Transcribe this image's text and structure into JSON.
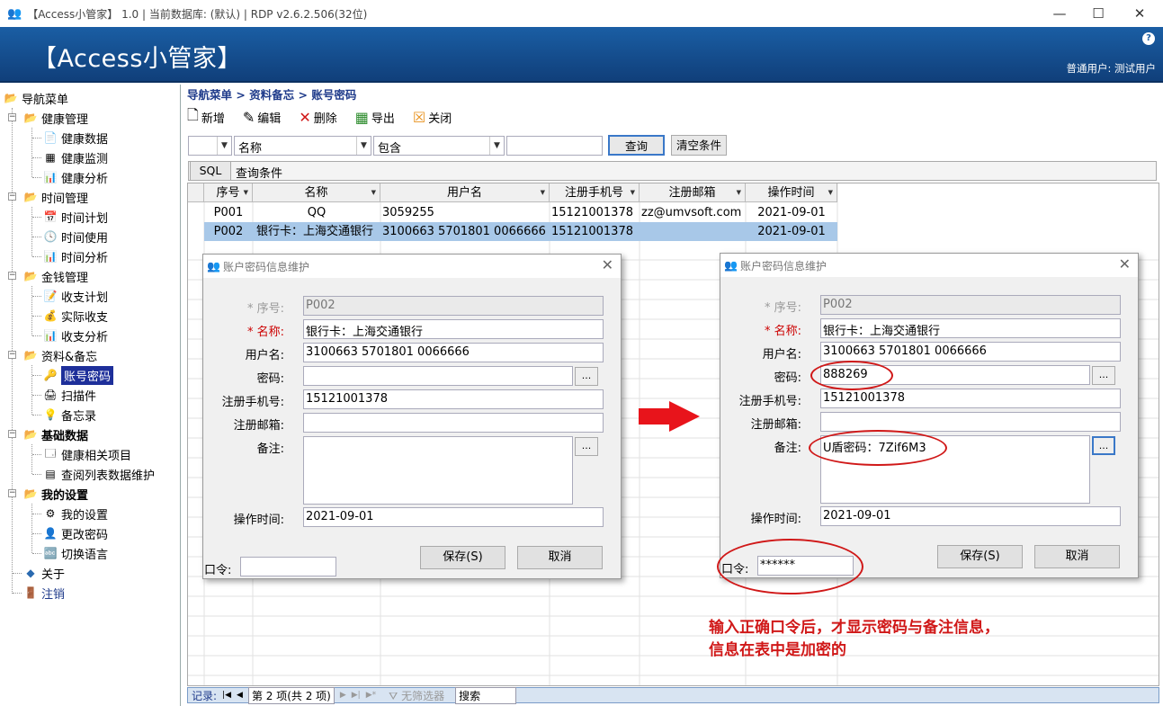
{
  "titlebar": {
    "text": "【Access小管家】 1.0 | 当前数据库: (默认) | RDP v2.6.2.506(32位)"
  },
  "banner": {
    "title": "【Access小管家】",
    "user": "普通用户: 测试用户",
    "help": "?"
  },
  "nav": {
    "root": "导航菜单",
    "groups": [
      {
        "label": "健康管理",
        "items": [
          "健康数据",
          "健康监测",
          "健康分析"
        ]
      },
      {
        "label": "时间管理",
        "items": [
          "时间计划",
          "时间使用",
          "时间分析"
        ]
      },
      {
        "label": "金钱管理",
        "items": [
          "收支计划",
          "实际收支",
          "收支分析"
        ]
      },
      {
        "label": "资料&备忘",
        "items": [
          "账号密码",
          "扫描件",
          "备忘录"
        ]
      },
      {
        "label": "基础数据",
        "items": [
          "健康相关项目",
          "查阅列表数据维护"
        ]
      },
      {
        "label": "我的设置",
        "items": [
          "我的设置",
          "更改密码",
          "切换语言"
        ]
      }
    ],
    "about": "关于",
    "logout": "注销"
  },
  "breadcrumb": "导航菜单 > 资料备忘 > 账号密码",
  "toolbar": {
    "new": "新增",
    "edit": "编辑",
    "delete": "删除",
    "export": "导出",
    "close": "关闭"
  },
  "filter": {
    "field": "名称",
    "op": "包含",
    "value": "",
    "query": "查询",
    "clear": "清空条件",
    "sql": "SQL",
    "sql_text": "查询条件"
  },
  "grid": {
    "headers": [
      "序号",
      "名称",
      "用户名",
      "注册手机号",
      "注册邮箱",
      "操作时间"
    ],
    "rows": [
      [
        "P001",
        "QQ",
        "3059255",
        "15121001378",
        "zz@umvsoft.com",
        "2021-09-01"
      ],
      [
        "P002",
        "银行卡：上海交通银行",
        "3100663 5701801 0066666",
        "15121001378",
        "",
        "2021-09-01"
      ]
    ]
  },
  "status": {
    "records": "记录:",
    "nav": "第 2 项(共 2 项)",
    "nofilter": "无筛选器",
    "search": "搜索"
  },
  "dialog1": {
    "title": "账户密码信息维护",
    "labels": {
      "seq": "* 序号:",
      "name": "* 名称:",
      "user": "用户名:",
      "pwd": "密码:",
      "phone": "注册手机号:",
      "email": "注册邮箱:",
      "note": "备注:",
      "time": "操作时间:"
    },
    "values": {
      "seq": "P002",
      "name": "银行卡：上海交通银行",
      "user": "3100663 5701801 0066666",
      "pwd": "",
      "phone": "15121001378",
      "email": "",
      "note": "",
      "time": "2021-09-01"
    },
    "cmd": "口令:",
    "cmd_value": "",
    "save": "保存(S)",
    "cancel": "取消",
    "dots": "..."
  },
  "dialog2": {
    "title": "账户密码信息维护",
    "labels": {
      "seq": "* 序号:",
      "name": "* 名称:",
      "user": "用户名:",
      "pwd": "密码:",
      "phone": "注册手机号:",
      "email": "注册邮箱:",
      "note": "备注:",
      "time": "操作时间:"
    },
    "values": {
      "seq": "P002",
      "name": "银行卡：上海交通银行",
      "user": "3100663 5701801 0066666",
      "pwd": "888269",
      "phone": "15121001378",
      "email": "",
      "note": "U盾密码：7Zif6M3",
      "time": "2021-09-01"
    },
    "cmd": "口令:",
    "cmd_value": "******",
    "save": "保存(S)",
    "cancel": "取消",
    "dots": "..."
  },
  "annotation": {
    "line1": "输入正确口令后，才显示密码与备注信息，",
    "line2": "信息在表中是加密的"
  },
  "colors": {
    "banner": "#1a5ea4",
    "accent_red": "#d01818",
    "selection": "#a8c8e8"
  }
}
